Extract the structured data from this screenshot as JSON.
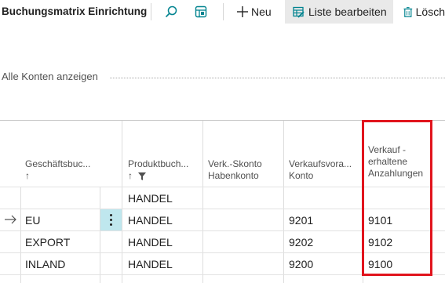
{
  "page_title": "Buchungsmatrix Einrichtung",
  "toolbar": {
    "new_label": "Neu",
    "edit_list_label": "Liste bearbeiten",
    "delete_label": "Lösch"
  },
  "filter": {
    "show_all_label": "Alle Konten anzeigen"
  },
  "columns": {
    "business_group": {
      "label": "Geschäftsbuc...",
      "sort": "↑"
    },
    "product_group": {
      "label": "Produktbuch...",
      "sort": "↑"
    },
    "discount_line1": "Verk.-Skonto",
    "discount_line2": "Habenkonto",
    "sales_line1": "Verkaufsvora...",
    "sales_line2": "Konto",
    "prepay_line1": "Verkauf -",
    "prepay_line2": "erhaltene",
    "prepay_line3": "Anzahlungen"
  },
  "rows": [
    {
      "business": "",
      "product": "HANDEL",
      "discount": "",
      "sales": "",
      "prepayment": ""
    },
    {
      "business": "EU",
      "product": "HANDEL",
      "discount": "",
      "sales": "9201",
      "prepayment": "9101"
    },
    {
      "business": "EXPORT",
      "product": "HANDEL",
      "discount": "",
      "sales": "9202",
      "prepayment": "9102"
    },
    {
      "business": "INLAND",
      "product": "HANDEL",
      "discount": "",
      "sales": "9200",
      "prepayment": "9100"
    }
  ],
  "colors": {
    "highlight": "#e1141d",
    "selected_cell": "#bfe7ee",
    "accent": "#00838f"
  }
}
